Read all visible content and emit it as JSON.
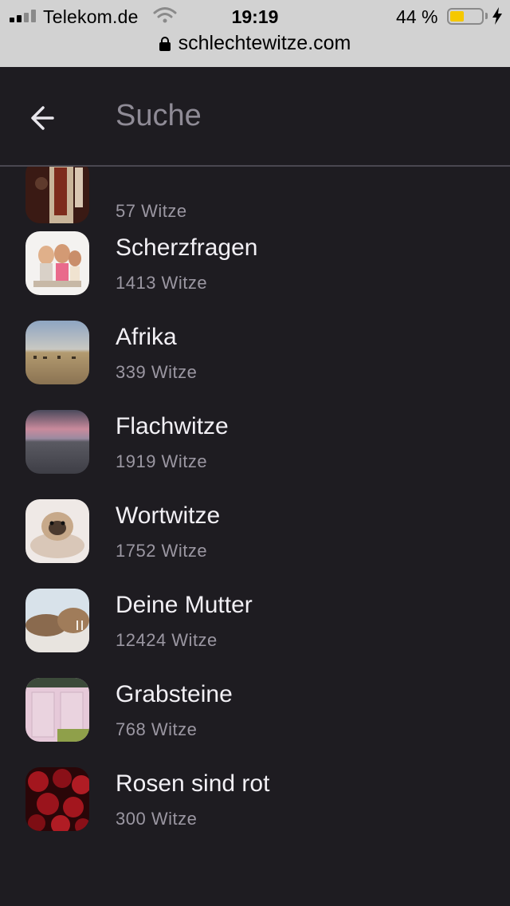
{
  "status_bar": {
    "carrier": "Telekom.de",
    "time": "19:19",
    "battery_percent": "44 %",
    "battery_level": 0.44,
    "url": "schlechtewitze.com"
  },
  "header": {
    "back_icon": "arrow-left-icon",
    "title": "Suche"
  },
  "categories": [
    {
      "title": "",
      "count": "57 Witze",
      "thumb_colors": [
        "#3a1a14",
        "#c9b59a"
      ]
    },
    {
      "title": "Scherzfragen",
      "count": "1413 Witze",
      "thumb_colors": [
        "#f4f2f0",
        "#e0b08a"
      ]
    },
    {
      "title": "Afrika",
      "count": "339 Witze",
      "thumb_colors": [
        "#9eb3c9",
        "#b59a6e"
      ]
    },
    {
      "title": "Flachwitze",
      "count": "1919 Witze",
      "thumb_colors": [
        "#c98a9c",
        "#5a5a62"
      ]
    },
    {
      "title": "Wortwitze",
      "count": "1752 Witze",
      "thumb_colors": [
        "#efe9e6",
        "#c7a98a"
      ]
    },
    {
      "title": "Deine Mutter",
      "count": "12424 Witze",
      "thumb_colors": [
        "#d8e2ea",
        "#8a6a4e"
      ]
    },
    {
      "title": "Grabsteine",
      "count": "768 Witze",
      "thumb_colors": [
        "#3c4a3a",
        "#e6c9d9"
      ]
    },
    {
      "title": "Rosen sind rot",
      "count": "300 Witze",
      "thumb_colors": [
        "#2a0608",
        "#a3161e"
      ]
    }
  ]
}
